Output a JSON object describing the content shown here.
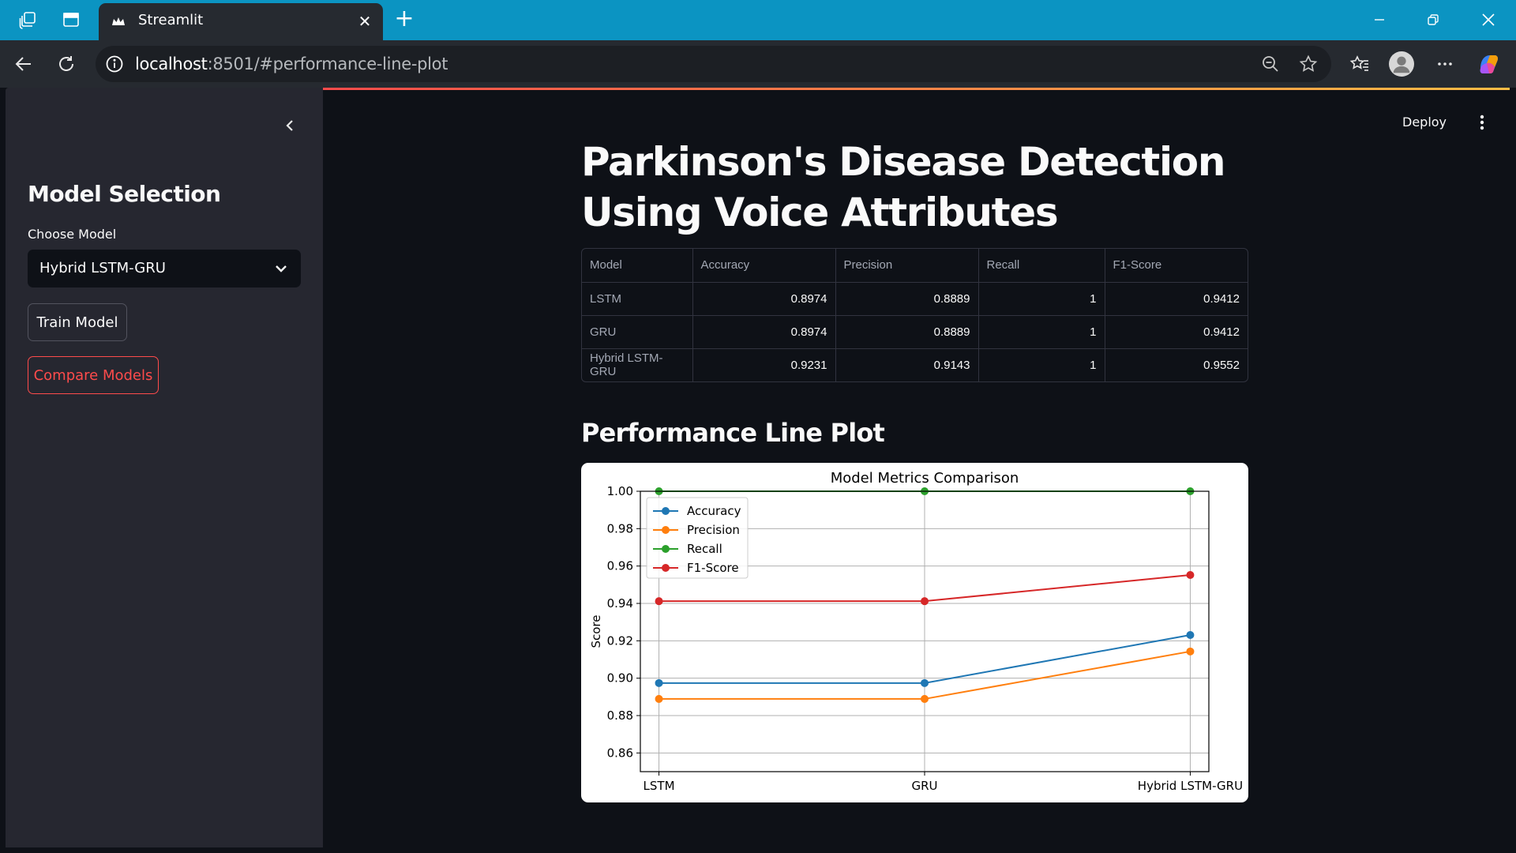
{
  "browser": {
    "tab_title": "Streamlit",
    "url_host": "localhost",
    "url_rest": ":8501/#performance-line-plot"
  },
  "sidebar": {
    "heading": "Model Selection",
    "select_label": "Choose Model",
    "select_value": "Hybrid LSTM-GRU",
    "train_button": "Train Model",
    "compare_button": "Compare Models"
  },
  "header": {
    "deploy_label": "Deploy"
  },
  "main": {
    "title": "Parkinson's Disease Detection Using Voice Attributes",
    "table": {
      "columns": [
        "Model",
        "Accuracy",
        "Precision",
        "Recall",
        "F1-Score"
      ],
      "rows": [
        [
          "LSTM",
          "0.8974",
          "0.8889",
          "1",
          "0.9412"
        ],
        [
          "GRU",
          "0.8974",
          "0.8889",
          "1",
          "0.9412"
        ],
        [
          "Hybrid LSTM-GRU",
          "0.9231",
          "0.9143",
          "1",
          "0.9552"
        ]
      ]
    },
    "chart_heading": "Performance Line Plot"
  },
  "colors": {
    "accent": "#ff4b4b",
    "accuracy": "#1f77b4",
    "precision": "#ff7f0e",
    "recall": "#2ca02c",
    "f1": "#d62728"
  },
  "chart_data": {
    "type": "line",
    "title": "Model Metrics Comparison",
    "xlabel": "",
    "ylabel": "Score",
    "categories": [
      "LSTM",
      "GRU",
      "Hybrid LSTM-GRU"
    ],
    "series": [
      {
        "name": "Accuracy",
        "values": [
          0.8974,
          0.8974,
          0.9231
        ],
        "color": "#1f77b4"
      },
      {
        "name": "Precision",
        "values": [
          0.8889,
          0.8889,
          0.9143
        ],
        "color": "#ff7f0e"
      },
      {
        "name": "Recall",
        "values": [
          1.0,
          1.0,
          1.0
        ],
        "color": "#2ca02c"
      },
      {
        "name": "F1-Score",
        "values": [
          0.9412,
          0.9412,
          0.9552
        ],
        "color": "#d62728"
      }
    ],
    "ylim": [
      0.85,
      1.0
    ],
    "yticks": [
      "0.86",
      "0.88",
      "0.90",
      "0.92",
      "0.94",
      "0.96",
      "0.98",
      "1.00"
    ],
    "grid": true,
    "legend_position": "upper-left"
  }
}
